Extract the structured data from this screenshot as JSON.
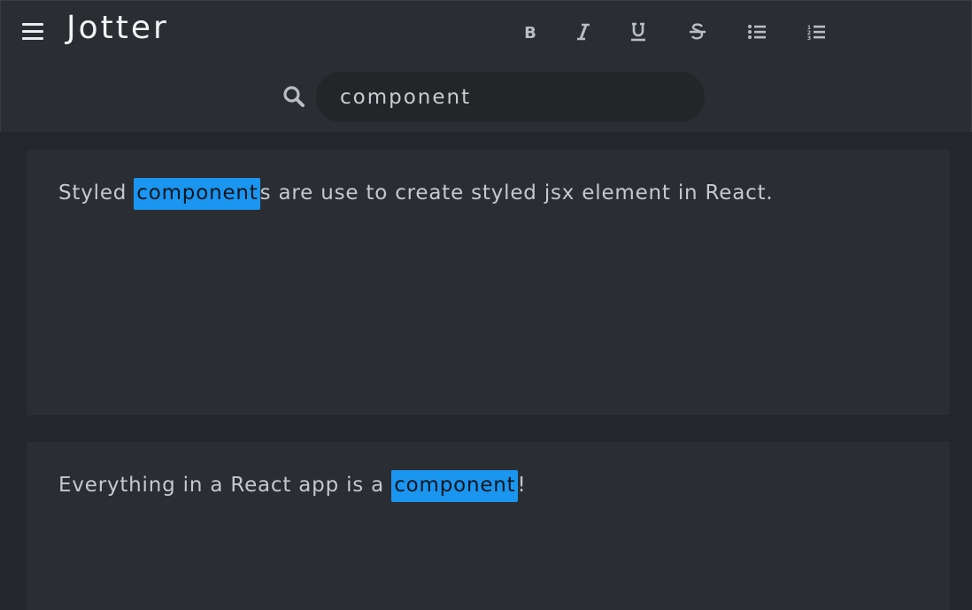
{
  "app": {
    "title": "Jotter"
  },
  "toolbar": {
    "items": [
      {
        "name": "bold",
        "icon": "bold-icon"
      },
      {
        "name": "italic",
        "icon": "italic-icon"
      },
      {
        "name": "underline",
        "icon": "underline-icon"
      },
      {
        "name": "strikethrough",
        "icon": "strikethrough-icon"
      },
      {
        "name": "bulleted-list",
        "icon": "bulleted-list-icon"
      },
      {
        "name": "numbered-list",
        "icon": "numbered-list-icon"
      }
    ]
  },
  "search": {
    "value": "component",
    "icon": "search-icon"
  },
  "notes": [
    {
      "before": "Styled ",
      "match": "component",
      "after": "s are use to create styled jsx element in React."
    },
    {
      "before": "Everything in a React app is a ",
      "match": "component",
      "after": "!"
    }
  ],
  "colors": {
    "highlight": "#1a96f0",
    "header_bg": "#2a2e32",
    "page_bg": "#23272b",
    "note_bg": "#2a2e32"
  }
}
